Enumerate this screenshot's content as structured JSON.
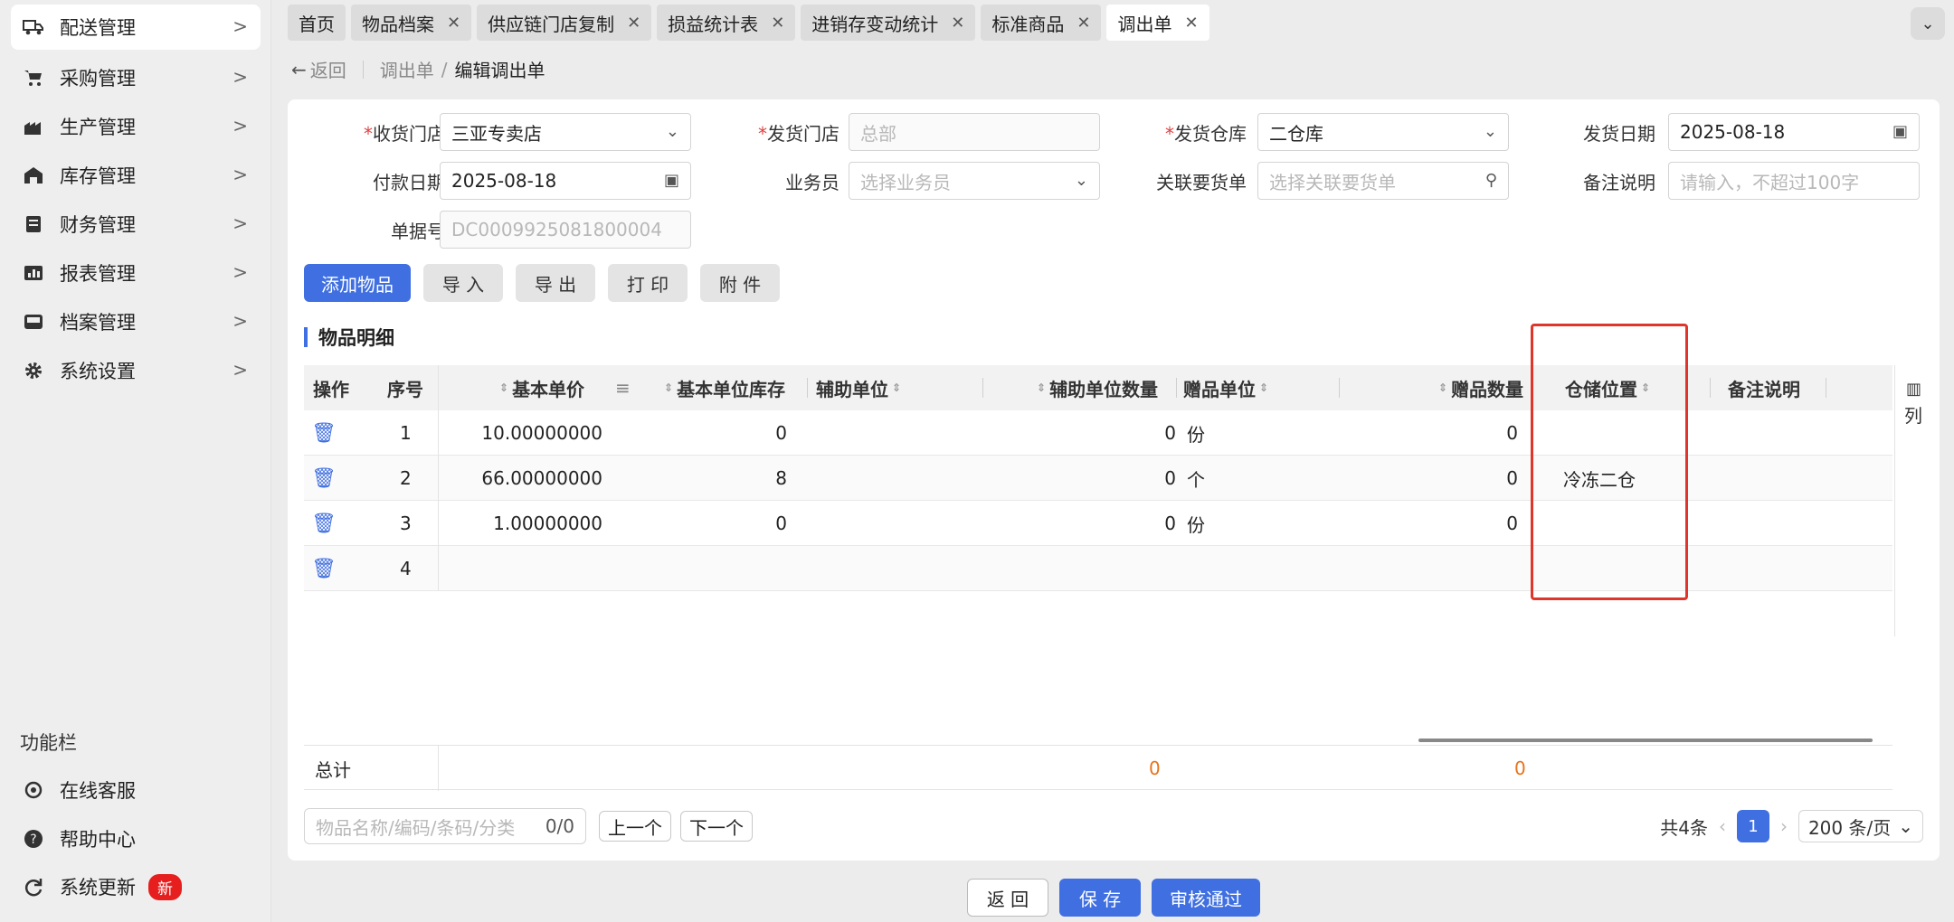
{
  "sidebar": {
    "items": [
      {
        "label": "配送管理",
        "icon": "truck-icon"
      },
      {
        "label": "采购管理",
        "icon": "cart-icon"
      },
      {
        "label": "生产管理",
        "icon": "factory-icon"
      },
      {
        "label": "库存管理",
        "icon": "warehouse-icon"
      },
      {
        "label": "财务管理",
        "icon": "ledger-icon"
      },
      {
        "label": "报表管理",
        "icon": "report-icon"
      },
      {
        "label": "档案管理",
        "icon": "archive-icon"
      },
      {
        "label": "系统设置",
        "icon": "gear-icon"
      }
    ],
    "func_title": "功能栏",
    "func_items": [
      {
        "label": "在线客服",
        "icon": "headset-icon"
      },
      {
        "label": "帮助中心",
        "icon": "help-icon"
      },
      {
        "label": "系统更新",
        "icon": "refresh-icon",
        "badge": "新"
      }
    ]
  },
  "tabs": [
    {
      "label": "首页",
      "closable": false
    },
    {
      "label": "物品档案",
      "closable": true
    },
    {
      "label": "供应链门店复制",
      "closable": true
    },
    {
      "label": "损益统计表",
      "closable": true
    },
    {
      "label": "进销存变动统计",
      "closable": true
    },
    {
      "label": "标准商品",
      "closable": true
    },
    {
      "label": "调出单",
      "closable": true,
      "active": true
    }
  ],
  "breadcrumb": {
    "back": "返回",
    "parent": "调出单",
    "sep": "/",
    "current": "编辑调出单"
  },
  "form": {
    "receive_store": {
      "label": "收货门店",
      "value": "三亚专卖店"
    },
    "send_store": {
      "label": "发货门店",
      "placeholder": "总部"
    },
    "send_warehouse": {
      "label": "发货仓库",
      "value": "二仓库"
    },
    "send_date": {
      "label": "发货日期",
      "value": "2025-08-18"
    },
    "pay_date": {
      "label": "付款日期",
      "value": "2025-08-18"
    },
    "salesman": {
      "label": "业务员",
      "placeholder": "选择业务员"
    },
    "related_order": {
      "label": "关联要货单",
      "placeholder": "选择关联要货单"
    },
    "remark": {
      "label": "备注说明",
      "placeholder": "请输入，不超过100字"
    },
    "doc_no": {
      "label": "单据号",
      "value": "DC0009925081800004"
    }
  },
  "actions": {
    "add": "添加物品",
    "import": "导 入",
    "export": "导 出",
    "print": "打 印",
    "attach": "附 件"
  },
  "section_title": "物品明细",
  "table": {
    "headers": {
      "op": "操作",
      "seq": "序号",
      "price": "基本单价",
      "stock": "基本单位库存",
      "aux_unit": "辅助单位",
      "aux_qty": "辅助单位数量",
      "gift_unit": "赠品单位",
      "gift_qty": "赠品数量",
      "location": "仓储位置",
      "remark": "备注说明"
    },
    "rows": [
      {
        "seq": "1",
        "price": "10.00000000",
        "stock": "0",
        "aux_qty": "0",
        "gift_unit": "份",
        "gift_qty": "0",
        "location": ""
      },
      {
        "seq": "2",
        "price": "66.00000000",
        "stock": "8",
        "aux_qty": "0",
        "gift_unit": "个",
        "gift_qty": "0",
        "location": "冷冻二仓"
      },
      {
        "seq": "3",
        "price": "1.00000000",
        "stock": "0",
        "aux_qty": "0",
        "gift_unit": "份",
        "gift_qty": "0",
        "location": ""
      },
      {
        "seq": "4",
        "price": "",
        "stock": "",
        "aux_qty": "",
        "gift_unit": "",
        "gift_qty": "",
        "location": ""
      }
    ],
    "column_setting": "列",
    "total_label": "总计",
    "total_aux_qty": "0",
    "total_gift_qty": "0"
  },
  "footer": {
    "search_placeholder": "物品名称/编码/条码/分类",
    "search_count": "0/0",
    "prev": "上一个",
    "next": "下一个",
    "total": "共4条",
    "page": "1",
    "page_size": "200 条/页"
  },
  "bottom": {
    "back": "返 回",
    "save": "保 存",
    "approve": "审核通过"
  },
  "colors": {
    "primary": "#3f6fe0",
    "danger": "#e0352b",
    "total": "#e8731a"
  }
}
